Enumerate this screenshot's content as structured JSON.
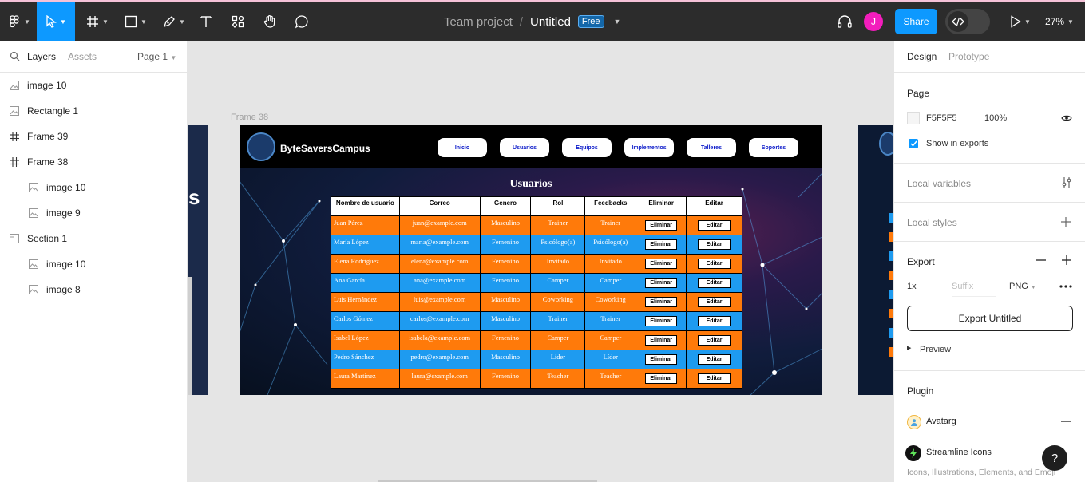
{
  "toolbar": {
    "title_team": "Team project",
    "title_sep": "/",
    "title_file": "Untitled",
    "badge": "Free",
    "avatar_initial": "J",
    "share_label": "Share",
    "zoom": "27%"
  },
  "layers_panel": {
    "tab_layers": "Layers",
    "tab_assets": "Assets",
    "page_selector": "Page 1",
    "items": [
      {
        "label": "image 10",
        "icon": "image-icon",
        "indent": false
      },
      {
        "label": "Rectangle 1",
        "icon": "image-icon",
        "indent": false
      },
      {
        "label": "Frame 39",
        "icon": "frame-icon",
        "indent": false
      },
      {
        "label": "Frame 38",
        "icon": "frame-icon",
        "indent": false
      },
      {
        "label": "image 10",
        "icon": "image-icon",
        "indent": true
      },
      {
        "label": "image 9",
        "icon": "image-icon",
        "indent": true
      },
      {
        "label": "Section 1",
        "icon": "section-icon",
        "indent": false
      },
      {
        "label": "image 10",
        "icon": "image-icon",
        "indent": true
      },
      {
        "label": "image 8",
        "icon": "image-icon",
        "indent": true
      }
    ]
  },
  "canvas": {
    "frame_label": "Frame 38",
    "left_frame_char": "s",
    "design": {
      "logo_text": "ByteSaversCampus",
      "nav": [
        "Inicio",
        "Usuarios",
        "Equipos",
        "Implementos",
        "Talleres",
        "Soportes"
      ],
      "title": "Usuarios",
      "headers": [
        "Nombre de usuario",
        "Correo",
        "Genero",
        "Rol",
        "Feedbacks",
        "Eliminar",
        "Editar"
      ],
      "delete_label": "Eliminar",
      "edit_label": "Editar",
      "rows": [
        {
          "name": "Juan Pérez",
          "email": "juan@example.com",
          "gender": "Masculino",
          "role": "Trainer",
          "feedback": "Trainer"
        },
        {
          "name": "María López",
          "email": "maria@example.com",
          "gender": "Femenino",
          "role": "Psicólogo(a)",
          "feedback": "Psicólogo(a)"
        },
        {
          "name": "Elena Rodríguez",
          "email": "elena@example.com",
          "gender": "Femenino",
          "role": "Invitado",
          "feedback": "Invitado"
        },
        {
          "name": "Ana García",
          "email": "ana@example.com",
          "gender": "Femenino",
          "role": "Camper",
          "feedback": "Camper"
        },
        {
          "name": "Luis Hernández",
          "email": "luis@example.com",
          "gender": "Masculino",
          "role": "Coworking",
          "feedback": "Coworking"
        },
        {
          "name": "Carlos Gómez",
          "email": "carlos@example.com",
          "gender": "Masculino",
          "role": "Trainer",
          "feedback": "Trainer"
        },
        {
          "name": "Isabel López",
          "email": "isabela@example.com",
          "gender": "Femenino",
          "role": "Camper",
          "feedback": "Camper"
        },
        {
          "name": "Pedro Sánchez",
          "email": "pedro@example.com",
          "gender": "Masculino",
          "role": "Líder",
          "feedback": "Líder"
        },
        {
          "name": "Laura Martínez",
          "email": "laura@example.com",
          "gender": "Femenino",
          "role": "Teacher",
          "feedback": "Teacher"
        }
      ],
      "row_colors": [
        "#ff7a0a",
        "#1e9bf0"
      ]
    }
  },
  "right_panel": {
    "tab_design": "Design",
    "tab_prototype": "Prototype",
    "page_title": "Page",
    "page_color": "F5F5F5",
    "page_opacity": "100%",
    "show_in_exports": "Show in exports",
    "local_variables": "Local variables",
    "local_styles": "Local styles",
    "export_title": "Export",
    "export_scale": "1x",
    "export_suffix_placeholder": "Suffix",
    "export_format": "PNG",
    "export_button": "Export Untitled",
    "preview": "Preview",
    "plugin_title": "Plugin",
    "plugins": [
      {
        "name": "Avatarg"
      },
      {
        "name": "Streamline Icons",
        "desc": "Icons, Illustrations, Elements, and Emoji"
      }
    ]
  },
  "colors": {
    "accent": "#0d99ff",
    "toolbar_bg": "#2c2c2c",
    "avatar": "#f31dbc"
  },
  "help_label": "?"
}
